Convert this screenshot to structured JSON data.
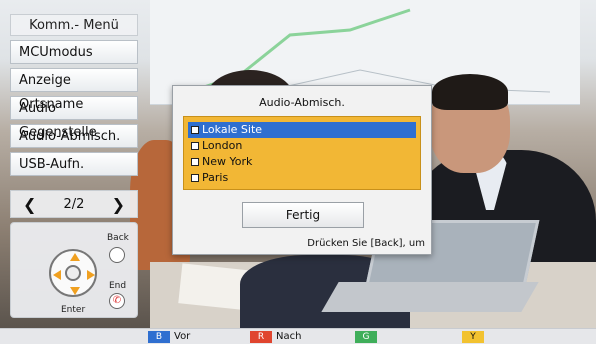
{
  "menu": {
    "title": "Komm.- Menü",
    "items": [
      {
        "label": "MCUmodus"
      },
      {
        "label": "Anzeige Ortsname"
      },
      {
        "label": "Audio Gegenstelle"
      },
      {
        "label": "Audio-Abmisch."
      },
      {
        "label": "USB-Aufn."
      }
    ],
    "pager": "2/2"
  },
  "remote": {
    "back_label": "Back",
    "end_label": "End",
    "enter_label": "Enter"
  },
  "dialog": {
    "title": "Audio-Abmisch.",
    "options": [
      {
        "label": "Lokale Site",
        "checked": false,
        "selected": true
      },
      {
        "label": "London",
        "checked": false,
        "selected": false
      },
      {
        "label": "New York",
        "checked": false,
        "selected": false
      },
      {
        "label": "Paris",
        "checked": false,
        "selected": false
      }
    ],
    "done_label": "Fertig",
    "hint": "Drücken Sie [Back], um"
  },
  "keys": [
    {
      "chip": "B",
      "label": "Vor",
      "color": "#2f6fd0"
    },
    {
      "chip": "R",
      "label": "Nach",
      "color": "#e0452f"
    },
    {
      "chip": "G",
      "label": "",
      "color": "#3fae5a"
    },
    {
      "chip": "Y",
      "label": "",
      "color": "#f2c230"
    }
  ]
}
